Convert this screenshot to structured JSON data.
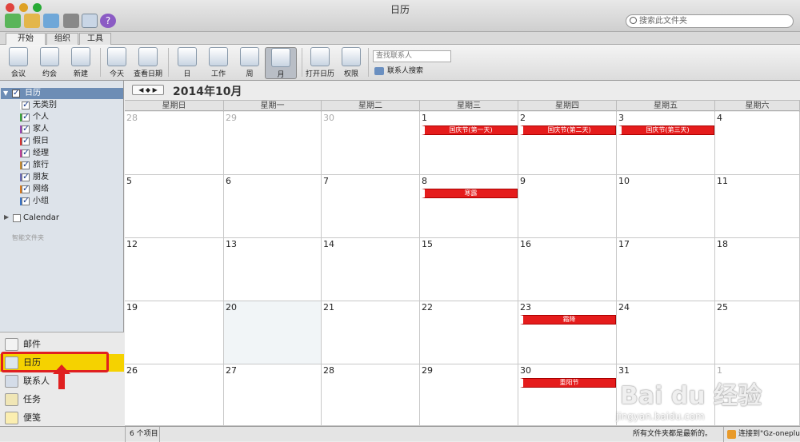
{
  "window": {
    "title": "日历"
  },
  "toolbar": {
    "search_placeholder": "搜索此文件夹"
  },
  "tabs": [
    {
      "label": "开始",
      "active": true
    },
    {
      "label": "组织"
    },
    {
      "label": "工具"
    }
  ],
  "ribbon": {
    "buttons": [
      "会议",
      "约会",
      "新建",
      "今天",
      "查看日期",
      "日",
      "工作",
      "周",
      "月",
      "打开日历",
      "权限"
    ],
    "active_view": "月",
    "contact_placeholder": "查找联系人",
    "contact_search": "联系人搜索"
  },
  "sidebar": {
    "root": "日历",
    "categories": [
      {
        "label": "无类别",
        "color": "#ffffff"
      },
      {
        "label": "个人",
        "color": "#3aa53a"
      },
      {
        "label": "家人",
        "color": "#9b46b5"
      },
      {
        "label": "假日",
        "color": "#d83131"
      },
      {
        "label": "经理",
        "color": "#c0409a"
      },
      {
        "label": "旅行",
        "color": "#c68a2e"
      },
      {
        "label": "朋友",
        "color": "#6a6ab5"
      },
      {
        "label": "网络",
        "color": "#d97a1d"
      },
      {
        "label": "小组",
        "color": "#3a74c8"
      }
    ],
    "calendar": "Calendar",
    "smart_folders": "智能文件夹",
    "nav": [
      {
        "label": "邮件",
        "active": false
      },
      {
        "label": "日历",
        "active": true
      },
      {
        "label": "联系人",
        "active": false
      },
      {
        "label": "任务",
        "active": false
      },
      {
        "label": "便笺",
        "active": false
      }
    ]
  },
  "calendar": {
    "month_title": "2014年10月",
    "nav_arrows": "◀ ◆ ▶",
    "weekdays": [
      "星期日",
      "星期一",
      "星期二",
      "星期三",
      "星期四",
      "星期五",
      "星期六"
    ],
    "weeks": [
      [
        "28",
        "29",
        "30",
        "1",
        "2",
        "3",
        "4"
      ],
      [
        "5",
        "6",
        "7",
        "8",
        "9",
        "10",
        "11"
      ],
      [
        "12",
        "13",
        "14",
        "15",
        "16",
        "17",
        "18"
      ],
      [
        "19",
        "20",
        "21",
        "22",
        "23",
        "24",
        "25"
      ],
      [
        "26",
        "27",
        "28",
        "29",
        "30",
        "31",
        "1"
      ]
    ],
    "events": [
      {
        "week": 0,
        "day": 3,
        "title": "国庆节(第一天)"
      },
      {
        "week": 0,
        "day": 4,
        "title": "国庆节(第二天)"
      },
      {
        "week": 0,
        "day": 5,
        "title": "国庆节(第三天)"
      },
      {
        "week": 1,
        "day": 3,
        "title": "寒露"
      },
      {
        "week": 3,
        "day": 4,
        "title": "霜降"
      },
      {
        "week": 4,
        "day": 4,
        "title": "重阳节"
      }
    ]
  },
  "status": {
    "count": "6 个项目",
    "sync": "所有文件夹都是最新的。",
    "connection": "连接到\"Gz-oneplus\""
  },
  "watermark": {
    "brand": "Bai du 经验",
    "url": "jingyan.baidu.com"
  }
}
